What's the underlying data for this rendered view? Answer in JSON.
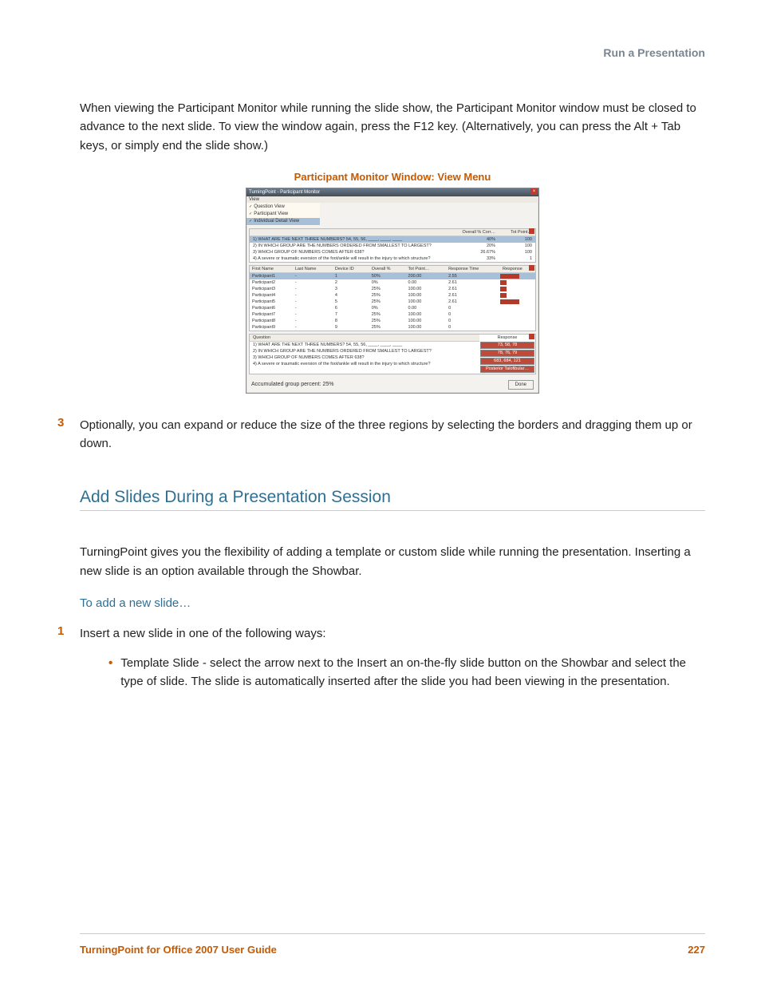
{
  "header": {
    "section": "Run a Presentation"
  },
  "p1": "When viewing the Participant Monitor while running the slide show, the Participant Monitor window must be closed to advance to the next slide. To view the window again, press the F12 key. (Alternatively, you can press the Alt + Tab keys, or simply end the slide show.)",
  "figure": {
    "caption": "Participant Monitor Window: View Menu"
  },
  "window": {
    "title": "TurningPoint - Participant Monitor",
    "menu": "View",
    "view_items": [
      "Question View",
      "Participant View",
      "Individual Detail View"
    ],
    "top_head_col1": "Overall % Corr…",
    "top_head_col2": "Tot Point…",
    "questions": [
      {
        "text": "1) WHAT ARE THE NEXT THREE NUMBERS?  54, 55, 56, ____, ____, ____",
        "pct": "40%",
        "pts": "100"
      },
      {
        "text": "2) IN WHICH GROUP ARE THE NUMBERS ORDERED FROM SMALLEST TO LARGEST?",
        "pct": "20%",
        "pts": "100"
      },
      {
        "text": "3) WHICH GROUP OF NUMBERS COMES AFTER 638?",
        "pct": "26.67%",
        "pts": "100"
      },
      {
        "text": "4) A severe or traumatic eversion of the foot/ankle will result in the injury to which structure?",
        "pct": "33%",
        "pts": "1"
      }
    ],
    "ptable_headers": [
      "First Name",
      "Last Name",
      "Device ID",
      "Overall %",
      "Tot Point…",
      "Response Time",
      "Response"
    ],
    "participants": [
      {
        "fn": "Participant1",
        "ln": "-",
        "id": "1",
        "pct": "50%",
        "pts": "200.00",
        "rt": "2.55",
        "bar": 55
      },
      {
        "fn": "Participant2",
        "ln": "-",
        "id": "2",
        "pct": "0%",
        "pts": "0.00",
        "rt": "2.61",
        "bar": 18
      },
      {
        "fn": "Participant3",
        "ln": "-",
        "id": "3",
        "pct": "25%",
        "pts": "100.00",
        "rt": "2.61",
        "bar": 18
      },
      {
        "fn": "Participant4",
        "ln": "-",
        "id": "4",
        "pct": "25%",
        "pts": "100.00",
        "rt": "2.61",
        "bar": 18
      },
      {
        "fn": "Participant5",
        "ln": "-",
        "id": "5",
        "pct": "25%",
        "pts": "100.00",
        "rt": "2.61",
        "bar": 55
      },
      {
        "fn": "Participant6",
        "ln": "-",
        "id": "6",
        "pct": "0%",
        "pts": "0.00",
        "rt": "0",
        "bar": 0
      },
      {
        "fn": "Participant7",
        "ln": "-",
        "id": "7",
        "pct": "25%",
        "pts": "100.00",
        "rt": "0",
        "bar": 0
      },
      {
        "fn": "Participant8",
        "ln": "-",
        "id": "8",
        "pct": "25%",
        "pts": "100.00",
        "rt": "0",
        "bar": 0
      },
      {
        "fn": "Participant9",
        "ln": "-",
        "id": "9",
        "pct": "25%",
        "pts": "100.00",
        "rt": "0",
        "bar": 0
      }
    ],
    "bottom_q_head": "Question",
    "bottom_resp_head": "Response",
    "bottom_questions": [
      "1) WHAT ARE THE NEXT THREE NUMBERS?  54, 55, 56, ____, ____, ____",
      "2) IN WHICH GROUP ARE THE NUMBERS ORDERED FROM SMALLEST TO LARGEST?",
      "3) WHICH GROUP OF NUMBERS COMES AFTER 638?",
      "4) A severe or traumatic eversion of the foot/ankle will result in the injury to which structure?"
    ],
    "bottom_responses": [
      "73, 58, 78",
      "78, 76, 79",
      "683, 684, 121",
      "Posterior Talofibular…"
    ],
    "status_text": "Accumulated group percent: 25%",
    "done": "Done"
  },
  "step3_num": "3",
  "step3_text": "Optionally, you can expand or reduce the size of the three regions by selecting the borders and dragging them up or down.",
  "section_title": "Add Slides During a Presentation Session",
  "p2": "TurningPoint gives you the flexibility of adding a template or custom slide while running the presentation. Inserting a new slide is an option available through the Showbar.",
  "subhead": "To add a new slide…",
  "step1_num": "1",
  "step1_text": "Insert a new slide in one of the following ways:",
  "bullet1": "Template Slide - select the arrow next to the Insert an on-the-fly slide button on the Showbar and select the type of slide. The slide is automatically inserted after the slide you had been viewing in the presentation.",
  "footer": {
    "left": "TurningPoint for Office 2007 User Guide",
    "right": "227"
  }
}
